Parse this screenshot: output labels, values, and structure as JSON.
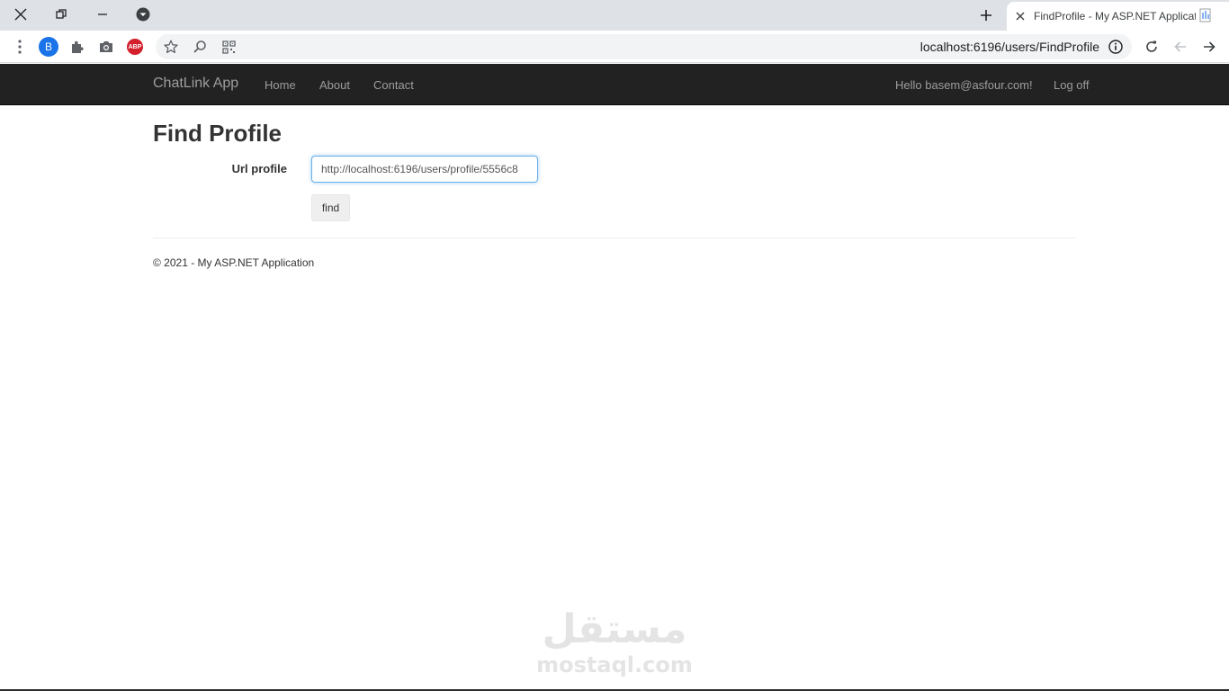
{
  "browser": {
    "tab": {
      "title": "FindProfile - My ASP.NET Application"
    },
    "new_tab_label": "+",
    "profile_initial": "B",
    "adblock_label": "ABP",
    "url": "localhost:6196/users/FindProfile"
  },
  "navbar": {
    "brand": "ChatLink App",
    "links": {
      "home": "Home",
      "about": "About",
      "contact": "Contact"
    },
    "greeting": "Hello basem@asfour.com!",
    "logoff": "Log off"
  },
  "main": {
    "title": "Find Profile",
    "url_label": "Url profile",
    "url_value": "http://localhost:6196/users/profile/5556c8",
    "find_label": "find"
  },
  "footer": {
    "text": "© 2021 - My ASP.NET Application"
  },
  "watermark": {
    "arabic": "مستقل",
    "latin": "mostaql.com"
  }
}
